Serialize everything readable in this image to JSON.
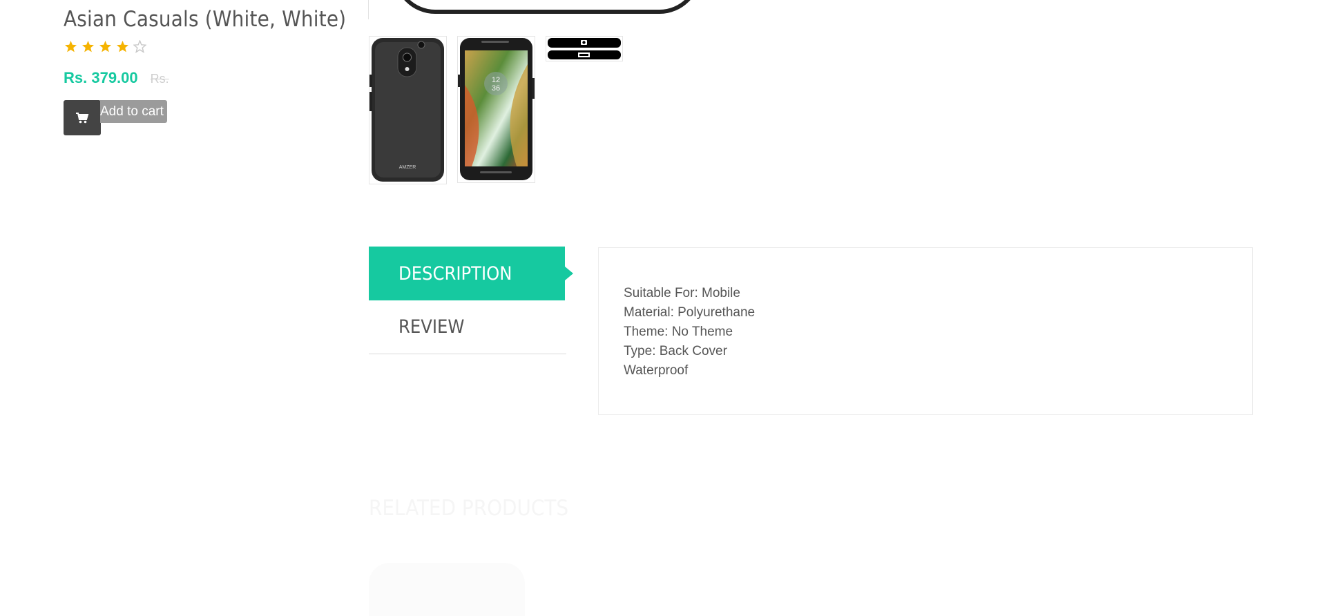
{
  "product": {
    "title": "Asian Casuals (White, White)",
    "rating": 4,
    "rating_max": 5,
    "price": "Rs. 379.00",
    "old_price": "Rs.",
    "add_to_cart_label": "Add to cart"
  },
  "colors": {
    "accent": "#16c9a0",
    "star_filled": "#f5b301",
    "star_empty": "#c8c8c8",
    "text": "#555555",
    "cart_dark": "#444444",
    "cart_label_bg": "#9b9b9b"
  },
  "gallery": {
    "thumbnails": [
      "phone-case-back",
      "phone-front-screen",
      "phone-case-edges"
    ],
    "screen_clock": [
      "12",
      "36"
    ],
    "brand_mark": "AMZER"
  },
  "tabs": [
    {
      "label": "Description",
      "active": true
    },
    {
      "label": "Review",
      "active": false
    }
  ],
  "description": {
    "lines": [
      "Suitable For: Mobile",
      "Material: Polyurethane",
      "Theme: No Theme",
      "Type: Back Cover",
      "Waterproof"
    ]
  },
  "related": {
    "title": "Related Products"
  }
}
